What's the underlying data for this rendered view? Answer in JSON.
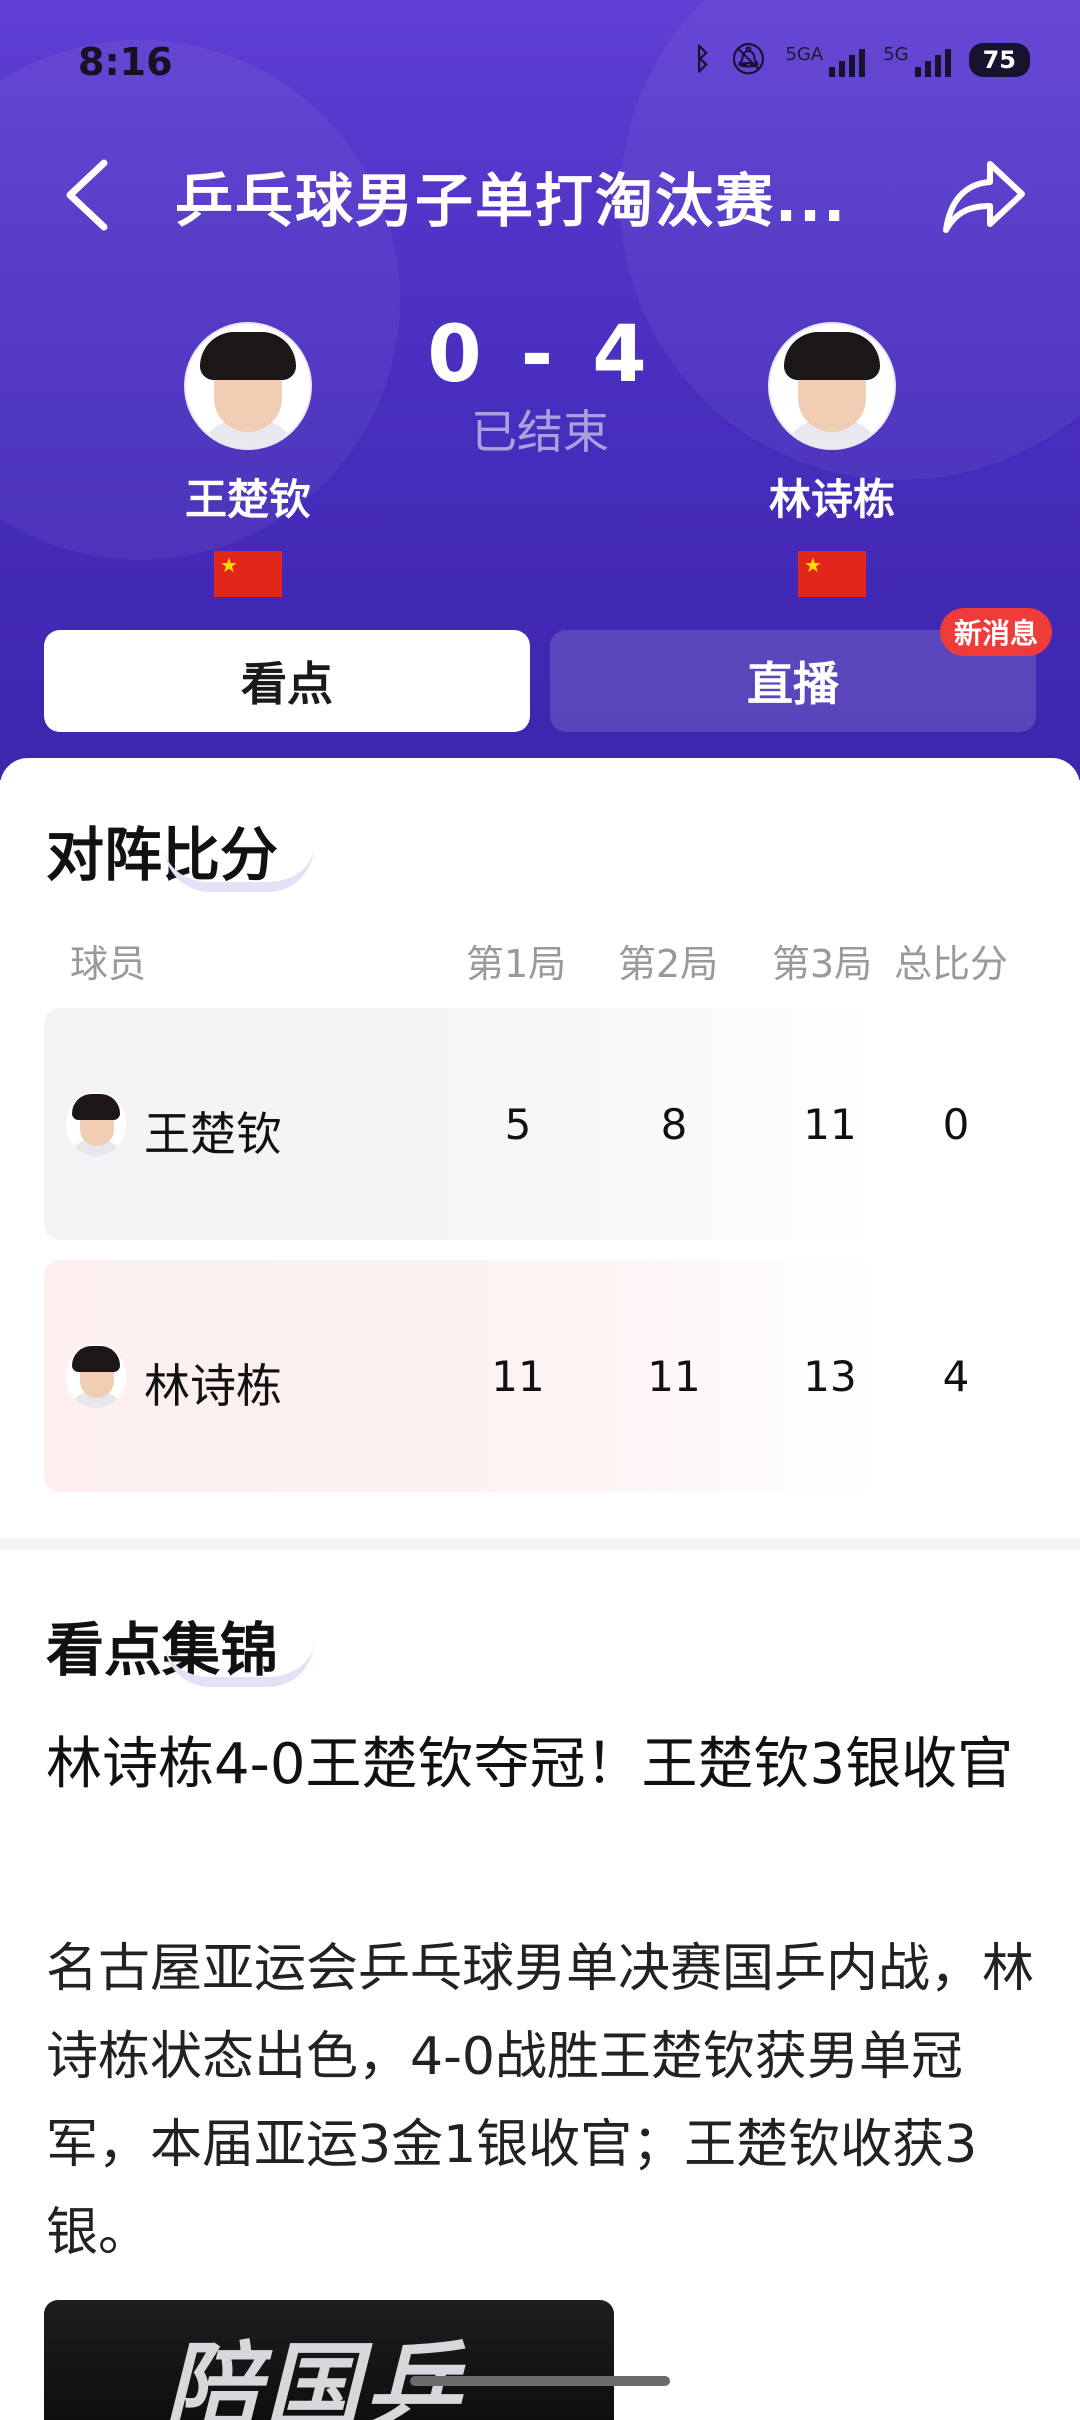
{
  "status_bar": {
    "time": "8:16",
    "net1": "5GA",
    "net2": "5G",
    "battery": "75"
  },
  "header": {
    "title": "乒乓球男子单打淘汰赛...",
    "back_icon": "chevron-left-icon",
    "share_icon": "share-icon"
  },
  "match": {
    "player1": {
      "name": "王楚钦",
      "flag": "china-flag"
    },
    "player2": {
      "name": "林诗栋",
      "flag": "china-flag"
    },
    "score": "0 - 4",
    "status": "已结束"
  },
  "tabs": [
    {
      "label": "看点",
      "active": true
    },
    {
      "label": "直播",
      "active": false,
      "badge": "新消息"
    }
  ],
  "scoreboard": {
    "title": "对阵比分",
    "headers": [
      "球员",
      "第1局",
      "第2局",
      "第3局",
      "总比分"
    ],
    "rows": [
      {
        "name": "王楚钦",
        "g1": "5",
        "g2": "8",
        "g3": "11",
        "total": "0"
      },
      {
        "name": "林诗栋",
        "g1": "11",
        "g2": "11",
        "g3": "13",
        "total": "4"
      }
    ]
  },
  "highlights": {
    "title": "看点集锦",
    "headline": "林诗栋4-0王楚钦夺冠！王楚钦3银收官",
    "body": "名古屋亚运会乒乓球男单决赛国乒内战，林诗栋状态出色，4-0战胜王楚钦获男单冠军，本届亚运3金1银收官；王楚钦收获3银。",
    "thumb_text": "陪国乒"
  },
  "colors": {
    "header_bg": "#4a2fc0",
    "badge": "#f03b3b",
    "flag": "#e2261c"
  }
}
